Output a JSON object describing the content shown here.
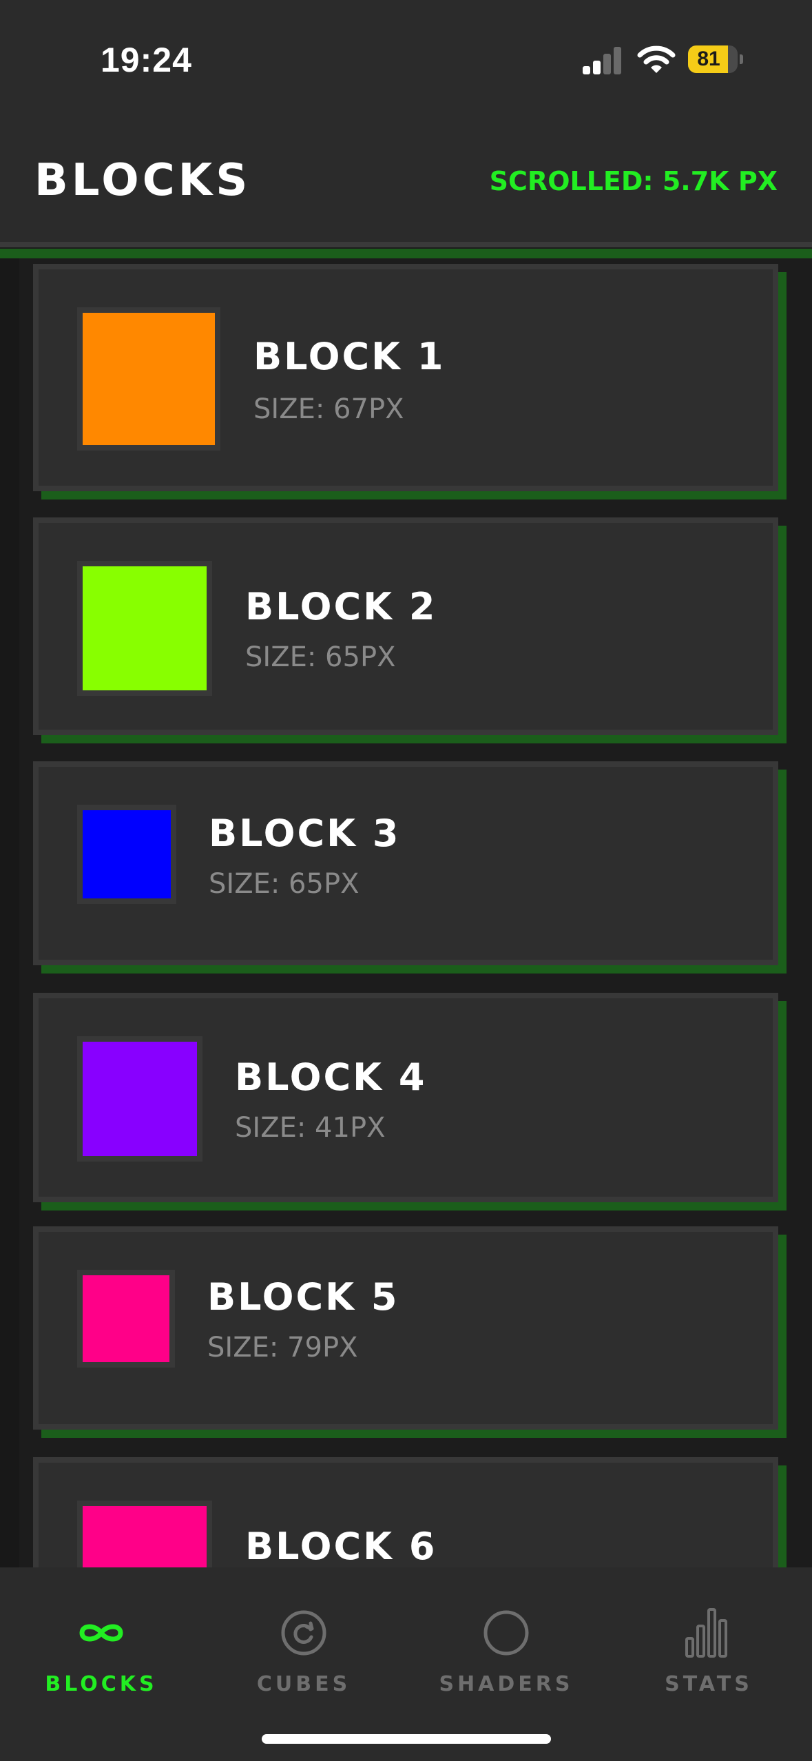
{
  "status_bar": {
    "time": "19:24",
    "battery_percent": 81,
    "battery_text": "81",
    "signal_bars_active": 2,
    "signal_bars_total": 4,
    "colors": {
      "battery": "#f5cc17"
    }
  },
  "header": {
    "title": "BLOCKS",
    "scroll_counter": "SCROLLED: 5.7K PX"
  },
  "blocks": [
    {
      "title": "BLOCK 1",
      "size_label": "SIZE: 67PX",
      "color": "#ff8800"
    },
    {
      "title": "BLOCK 2",
      "size_label": "SIZE: 65PX",
      "color": "#88ff00"
    },
    {
      "title": "BLOCK 3",
      "size_label": "SIZE: 65PX",
      "color": "#0000ff"
    },
    {
      "title": "BLOCK 4",
      "size_label": "SIZE: 41PX",
      "color": "#8800ff"
    },
    {
      "title": "BLOCK 5",
      "size_label": "SIZE: 79PX",
      "color": "#ff0088"
    },
    {
      "title": "BLOCK 6",
      "size_label": "",
      "color": "#ff0088"
    }
  ],
  "tab_bar": {
    "tabs": [
      {
        "label": "BLOCKS",
        "icon": "infinity-icon",
        "active": true
      },
      {
        "label": "CUBES",
        "icon": "refresh-circle-icon",
        "active": false
      },
      {
        "label": "SHADERS",
        "icon": "circle-icon",
        "active": false
      },
      {
        "label": "STATS",
        "icon": "bar-chart-icon",
        "active": false
      }
    ]
  },
  "theme": {
    "accent": "#22ee22",
    "accent_dark": "#1b5e1b",
    "card_bg": "#2e2e2e",
    "muted_text": "#8a8a8a"
  }
}
